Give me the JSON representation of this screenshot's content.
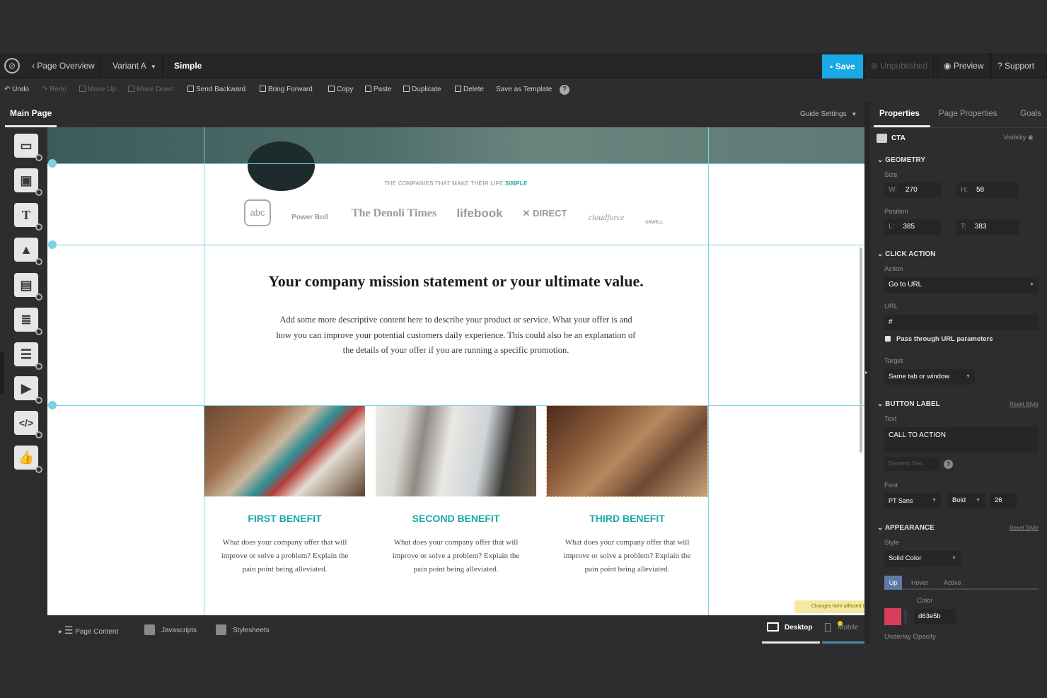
{
  "topbar": {
    "page_overview": "Page Overview",
    "variant": "Variant A",
    "page_name": "Simple",
    "save": "Save",
    "unpublished": "Unpublished",
    "preview": "Preview",
    "support": "Support"
  },
  "toolbar": {
    "undo": "Undo",
    "redo": "Redo",
    "move_up": "Move Up",
    "move_down": "Move Down",
    "send_backward": "Send Backward",
    "bring_forward": "Bring Forward",
    "copy": "Copy",
    "paste": "Paste",
    "duplicate": "Duplicate",
    "delete": "Delete",
    "save_as_template": "Save as Template"
  },
  "tabs": {
    "main_page": "Main Page",
    "guide_settings": "Guide Settings"
  },
  "canvas": {
    "companies_title": "THE COMPANIES THAT MAKE THEIR LIFE",
    "companies_title_accent": "SIMPLE",
    "logos": [
      "abc",
      "Power",
      "Bull",
      "The Denoli Times",
      "lifebook",
      "DIRECT",
      "cloudforce",
      "ORWELL"
    ],
    "mission_heading": "Your company mission statement or your ultimate value.",
    "mission_body": "Add some more descriptive content here to describe your product or service. What your offer is and how you can improve your potential customers daily experience. This could also be an explanation of the details of your offer if you are running a specific promotion.",
    "benefits": [
      {
        "title": "FIRST BENEFIT",
        "body": "What does your company offer that will improve or solve a problem? Explain the pain point being alleviated."
      },
      {
        "title": "SECOND BENEFIT",
        "body": "What does your company offer that will improve or solve a problem? Explain the pain point being alleviated."
      },
      {
        "title": "THIRD BENEFIT",
        "body": "What does your company offer that will improve or solve a problem? Explain the pain point being alleviated."
      }
    ]
  },
  "bottombar": {
    "page_content": "Page Content",
    "javascripts": "Javascripts",
    "stylesheets": "Stylesheets",
    "desktop": "Desktop",
    "mobile": "Mobile",
    "tooltip": "Changes here affected the other view"
  },
  "panel": {
    "tabs": [
      "Properties",
      "Page Properties",
      "Goals"
    ],
    "element_type": "CTA",
    "visibility": "Visibility",
    "geometry": {
      "title": "GEOMETRY",
      "size_label": "Size",
      "w_label": "W:",
      "w": "270",
      "h_label": "H:",
      "h": "58",
      "position_label": "Position",
      "l_label": "L:",
      "l": "385",
      "t_label": "T:",
      "t": "383"
    },
    "click_action": {
      "title": "CLICK ACTION",
      "action_label": "Action",
      "action_value": "Go to URL",
      "url_label": "URL",
      "url_value": "#",
      "pass_through": "Pass through URL parameters",
      "target_label": "Target",
      "target_value": "Same tab or window"
    },
    "button_label": {
      "title": "BUTTON LABEL",
      "reset": "Reset Style",
      "text_label": "Text",
      "text_value": "CALL TO ACTION",
      "dynamic_text": "Dynamic Text",
      "font_label": "Font",
      "font_family": "PT Sans",
      "font_weight": "Bold",
      "font_size": "26"
    },
    "appearance": {
      "title": "APPEARANCE",
      "reset": "Reset Style",
      "style_label": "Style",
      "style_value": "Solid Color",
      "states": [
        "Up",
        "Hover",
        "Active"
      ],
      "color_label": "Color",
      "color_value": "d63e5b",
      "color_hex": "#d63e5b",
      "underlay_label": "Underlay Opacity"
    }
  }
}
